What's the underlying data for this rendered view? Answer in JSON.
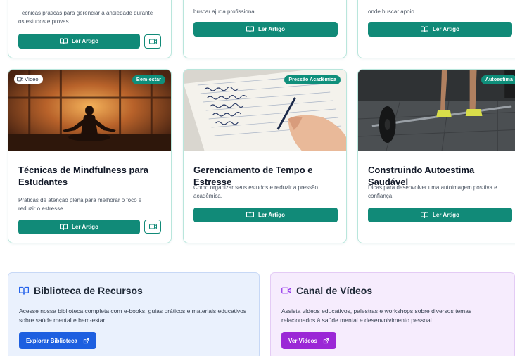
{
  "top_cards": [
    {
      "desc": "Técnicas práticas para gerenciar a ansiedade durante os estudos e provas.",
      "button": "Ler Artigo",
      "has_video": true
    },
    {
      "desc": "buscar ajuda profissional.",
      "button": "Ler Artigo",
      "has_video": false
    },
    {
      "desc": "onde buscar apoio.",
      "button": "Ler Artigo",
      "has_video": false
    }
  ],
  "cards": [
    {
      "badge": "Bem-estar",
      "video_chip": "Vídeo",
      "title": "Técnicas de Mindfulness para Estudantes",
      "desc": "Práticas de atenção plena para melhorar o foco e reduzir o estresse.",
      "button": "Ler Artigo",
      "has_video": true
    },
    {
      "badge": "Pressão Acadêmica",
      "title": "Gerenciamento de Tempo e Estresse",
      "desc": "Como organizar seus estudos e reduzir a pressão acadêmica.",
      "button": "Ler Artigo",
      "has_video": false
    },
    {
      "badge": "Autoestima",
      "title": "Construindo Autoestima Saudável",
      "desc": "Dicas para desenvolver uma autoimagem positiva e confiança.",
      "button": "Ler Artigo",
      "has_video": false
    }
  ],
  "library": {
    "title": "Biblioteca de Recursos",
    "desc": "Acesse nossa biblioteca completa com e-books, guias práticos e materiais educativos sobre saúde mental e bem-estar.",
    "button": "Explorar Biblioteca"
  },
  "videos": {
    "title": "Canal de Vídeos",
    "desc": "Assista vídeos educativos, palestras e workshops sobre diversos temas relacionados à saúde mental e desenvolvimento pessoal.",
    "button": "Ver Vídeos"
  },
  "colors": {
    "teal": "#118a78",
    "blue_button": "#1d5fe0",
    "purple_button": "#9b27d6",
    "blue_icon": "#2563eb",
    "purple_icon": "#9333ea"
  }
}
